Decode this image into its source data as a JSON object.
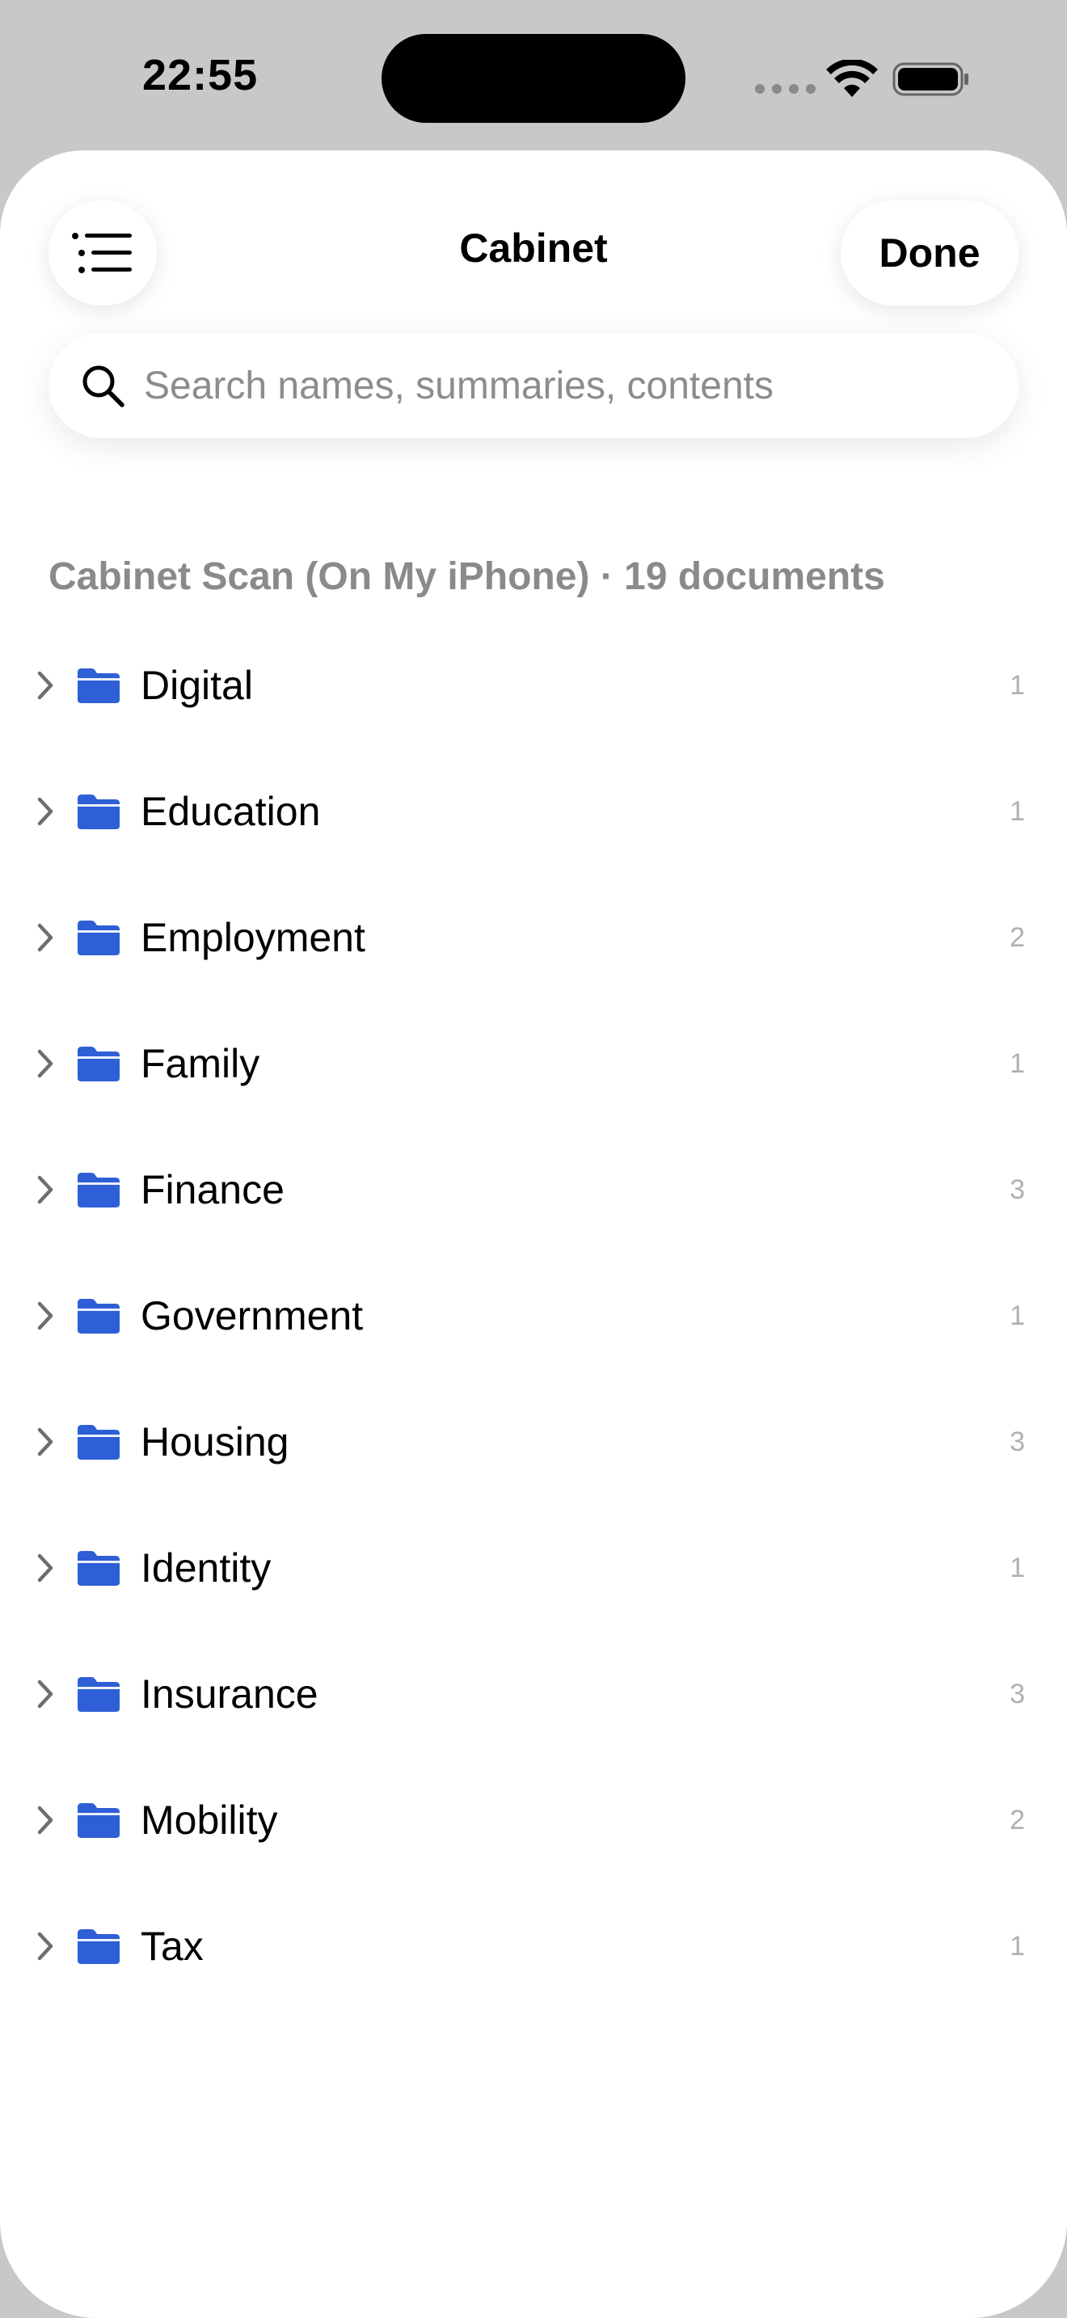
{
  "status_bar": {
    "time": "22:55"
  },
  "header": {
    "title": "Cabinet",
    "done_label": "Done",
    "menu_icon": "list-bullet-icon"
  },
  "search": {
    "placeholder": "Search names, summaries, contents",
    "value": ""
  },
  "section": {
    "label": "Cabinet Scan (On My iPhone) · 19 documents"
  },
  "folders": [
    {
      "name": "Digital",
      "count": "1"
    },
    {
      "name": "Education",
      "count": "1"
    },
    {
      "name": "Employment",
      "count": "2"
    },
    {
      "name": "Family",
      "count": "1"
    },
    {
      "name": "Finance",
      "count": "3"
    },
    {
      "name": "Government",
      "count": "1"
    },
    {
      "name": "Housing",
      "count": "3"
    },
    {
      "name": "Identity",
      "count": "1"
    },
    {
      "name": "Insurance",
      "count": "3"
    },
    {
      "name": "Mobility",
      "count": "2"
    },
    {
      "name": "Tax",
      "count": "1"
    }
  ],
  "colors": {
    "folder": "#2f5fd6",
    "chevron": "#6e6e6e",
    "count": "#b0b0b0",
    "section_header": "#8a8a8a"
  }
}
